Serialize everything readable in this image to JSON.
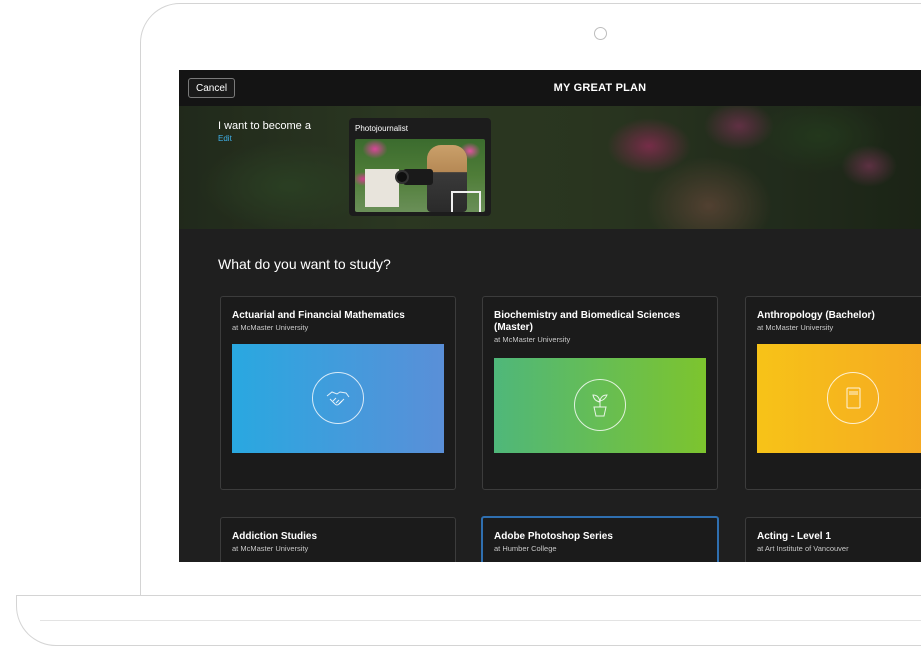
{
  "app": {
    "cancel_label": "Cancel",
    "title": "MY GREAT PLAN"
  },
  "hero": {
    "intro": "I want to become a",
    "edit_label": "Edit",
    "career": "Photojournalist"
  },
  "study": {
    "heading": "What do you want to study?",
    "programs": [
      {
        "title": "Actuarial and Financial Mathematics",
        "school": "at McMaster University",
        "icon": "handshake-icon",
        "colors": [
          "#29a8e0",
          "#5a8fd8"
        ]
      },
      {
        "title": "Biochemistry and Biomedical Sciences (Master)",
        "school": "at McMaster University",
        "icon": "plant-icon",
        "colors": [
          "#4fb77a",
          "#7dc42e"
        ]
      },
      {
        "title": "Anthropology (Bachelor)",
        "school": "at McMaster University",
        "icon": "book-icon",
        "colors": [
          "#f7c318",
          "#f5a623"
        ]
      },
      {
        "title": "Addiction Studies",
        "school": "at McMaster University"
      },
      {
        "title": "Adobe Photoshop Series",
        "school": "at Humber College",
        "selected": true
      },
      {
        "title": "Acting - Level 1",
        "school": "at Art Institute of Vancouver"
      }
    ]
  },
  "colors": {
    "screen_bg": "#1f1f1f",
    "topbar_bg": "#141414",
    "link": "#3fb0e8",
    "selected_border": "#2f6fb0"
  }
}
